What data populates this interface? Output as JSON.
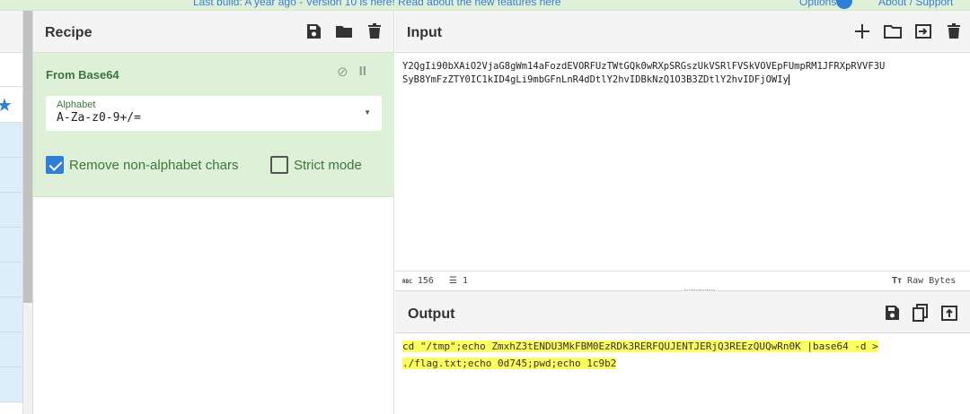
{
  "topbar": {
    "message": "Last build: A year ago - Version 10 is here! Read about the new features here",
    "options": "Options",
    "about": "About / Support"
  },
  "recipe": {
    "title": "Recipe",
    "operation": {
      "name": "From Base64",
      "alphabet_label": "Alphabet",
      "alphabet_value": "A-Za-z0-9+/=",
      "remove_label": "Remove non-alphabet chars",
      "remove_checked": true,
      "strict_label": "Strict mode",
      "strict_checked": false
    }
  },
  "input": {
    "title": "Input",
    "line1": "Y2QgIi90bXAiO2VjaG8gWm14aFozdEVORFUzTWtGQk0wRXpSRGszUkVSRlFVSkVOVEpFUmpRM1JFRXpRVVF3U",
    "line2": "SyB8YmFzZTY0IC1kID4gLi9mbGFnLnR4dDtlY2hvIDBkNzQ1O3B3ZDtlY2hvIDFjOWIy",
    "length": "156",
    "lines": "1",
    "encoding": "Raw Bytes"
  },
  "output": {
    "title": "Output",
    "line1": "cd \"/tmp\";echo ZmxhZ3tENDU3MkFBM0EzRDk3RERFQUJENTJERjQ3REEzQUQwRn0K |base64 -d > ",
    "line2": "./flag.txt;echo 0d745;pwd;echo 1c9b2"
  }
}
